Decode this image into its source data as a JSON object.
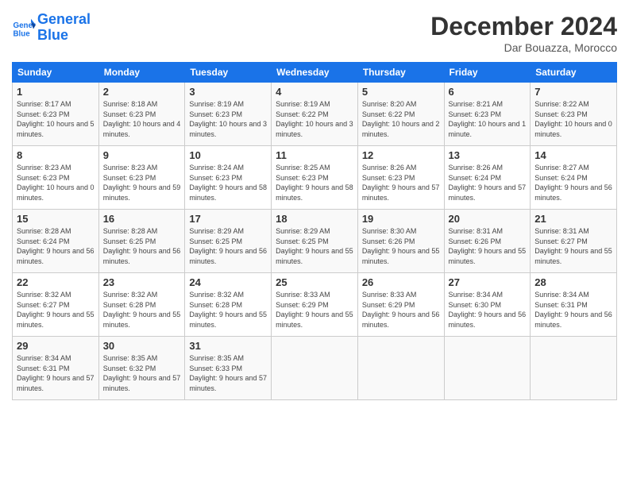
{
  "header": {
    "logo_line1": "General",
    "logo_line2": "Blue",
    "month": "December 2024",
    "location": "Dar Bouazza, Morocco"
  },
  "days_of_week": [
    "Sunday",
    "Monday",
    "Tuesday",
    "Wednesday",
    "Thursday",
    "Friday",
    "Saturday"
  ],
  "weeks": [
    [
      {
        "day": "1",
        "sunrise": "8:17 AM",
        "sunset": "6:23 PM",
        "daylight": "10 hours and 5 minutes."
      },
      {
        "day": "2",
        "sunrise": "8:18 AM",
        "sunset": "6:23 PM",
        "daylight": "10 hours and 4 minutes."
      },
      {
        "day": "3",
        "sunrise": "8:19 AM",
        "sunset": "6:23 PM",
        "daylight": "10 hours and 3 minutes."
      },
      {
        "day": "4",
        "sunrise": "8:19 AM",
        "sunset": "6:22 PM",
        "daylight": "10 hours and 3 minutes."
      },
      {
        "day": "5",
        "sunrise": "8:20 AM",
        "sunset": "6:22 PM",
        "daylight": "10 hours and 2 minutes."
      },
      {
        "day": "6",
        "sunrise": "8:21 AM",
        "sunset": "6:23 PM",
        "daylight": "10 hours and 1 minute."
      },
      {
        "day": "7",
        "sunrise": "8:22 AM",
        "sunset": "6:23 PM",
        "daylight": "10 hours and 0 minutes."
      }
    ],
    [
      {
        "day": "8",
        "sunrise": "8:23 AM",
        "sunset": "6:23 PM",
        "daylight": "10 hours and 0 minutes."
      },
      {
        "day": "9",
        "sunrise": "8:23 AM",
        "sunset": "6:23 PM",
        "daylight": "9 hours and 59 minutes."
      },
      {
        "day": "10",
        "sunrise": "8:24 AM",
        "sunset": "6:23 PM",
        "daylight": "9 hours and 58 minutes."
      },
      {
        "day": "11",
        "sunrise": "8:25 AM",
        "sunset": "6:23 PM",
        "daylight": "9 hours and 58 minutes."
      },
      {
        "day": "12",
        "sunrise": "8:26 AM",
        "sunset": "6:23 PM",
        "daylight": "9 hours and 57 minutes."
      },
      {
        "day": "13",
        "sunrise": "8:26 AM",
        "sunset": "6:24 PM",
        "daylight": "9 hours and 57 minutes."
      },
      {
        "day": "14",
        "sunrise": "8:27 AM",
        "sunset": "6:24 PM",
        "daylight": "9 hours and 56 minutes."
      }
    ],
    [
      {
        "day": "15",
        "sunrise": "8:28 AM",
        "sunset": "6:24 PM",
        "daylight": "9 hours and 56 minutes."
      },
      {
        "day": "16",
        "sunrise": "8:28 AM",
        "sunset": "6:25 PM",
        "daylight": "9 hours and 56 minutes."
      },
      {
        "day": "17",
        "sunrise": "8:29 AM",
        "sunset": "6:25 PM",
        "daylight": "9 hours and 56 minutes."
      },
      {
        "day": "18",
        "sunrise": "8:29 AM",
        "sunset": "6:25 PM",
        "daylight": "9 hours and 55 minutes."
      },
      {
        "day": "19",
        "sunrise": "8:30 AM",
        "sunset": "6:26 PM",
        "daylight": "9 hours and 55 minutes."
      },
      {
        "day": "20",
        "sunrise": "8:31 AM",
        "sunset": "6:26 PM",
        "daylight": "9 hours and 55 minutes."
      },
      {
        "day": "21",
        "sunrise": "8:31 AM",
        "sunset": "6:27 PM",
        "daylight": "9 hours and 55 minutes."
      }
    ],
    [
      {
        "day": "22",
        "sunrise": "8:32 AM",
        "sunset": "6:27 PM",
        "daylight": "9 hours and 55 minutes."
      },
      {
        "day": "23",
        "sunrise": "8:32 AM",
        "sunset": "6:28 PM",
        "daylight": "9 hours and 55 minutes."
      },
      {
        "day": "24",
        "sunrise": "8:32 AM",
        "sunset": "6:28 PM",
        "daylight": "9 hours and 55 minutes."
      },
      {
        "day": "25",
        "sunrise": "8:33 AM",
        "sunset": "6:29 PM",
        "daylight": "9 hours and 55 minutes."
      },
      {
        "day": "26",
        "sunrise": "8:33 AM",
        "sunset": "6:29 PM",
        "daylight": "9 hours and 56 minutes."
      },
      {
        "day": "27",
        "sunrise": "8:34 AM",
        "sunset": "6:30 PM",
        "daylight": "9 hours and 56 minutes."
      },
      {
        "day": "28",
        "sunrise": "8:34 AM",
        "sunset": "6:31 PM",
        "daylight": "9 hours and 56 minutes."
      }
    ],
    [
      {
        "day": "29",
        "sunrise": "8:34 AM",
        "sunset": "6:31 PM",
        "daylight": "9 hours and 57 minutes."
      },
      {
        "day": "30",
        "sunrise": "8:35 AM",
        "sunset": "6:32 PM",
        "daylight": "9 hours and 57 minutes."
      },
      {
        "day": "31",
        "sunrise": "8:35 AM",
        "sunset": "6:33 PM",
        "daylight": "9 hours and 57 minutes."
      },
      null,
      null,
      null,
      null
    ]
  ]
}
